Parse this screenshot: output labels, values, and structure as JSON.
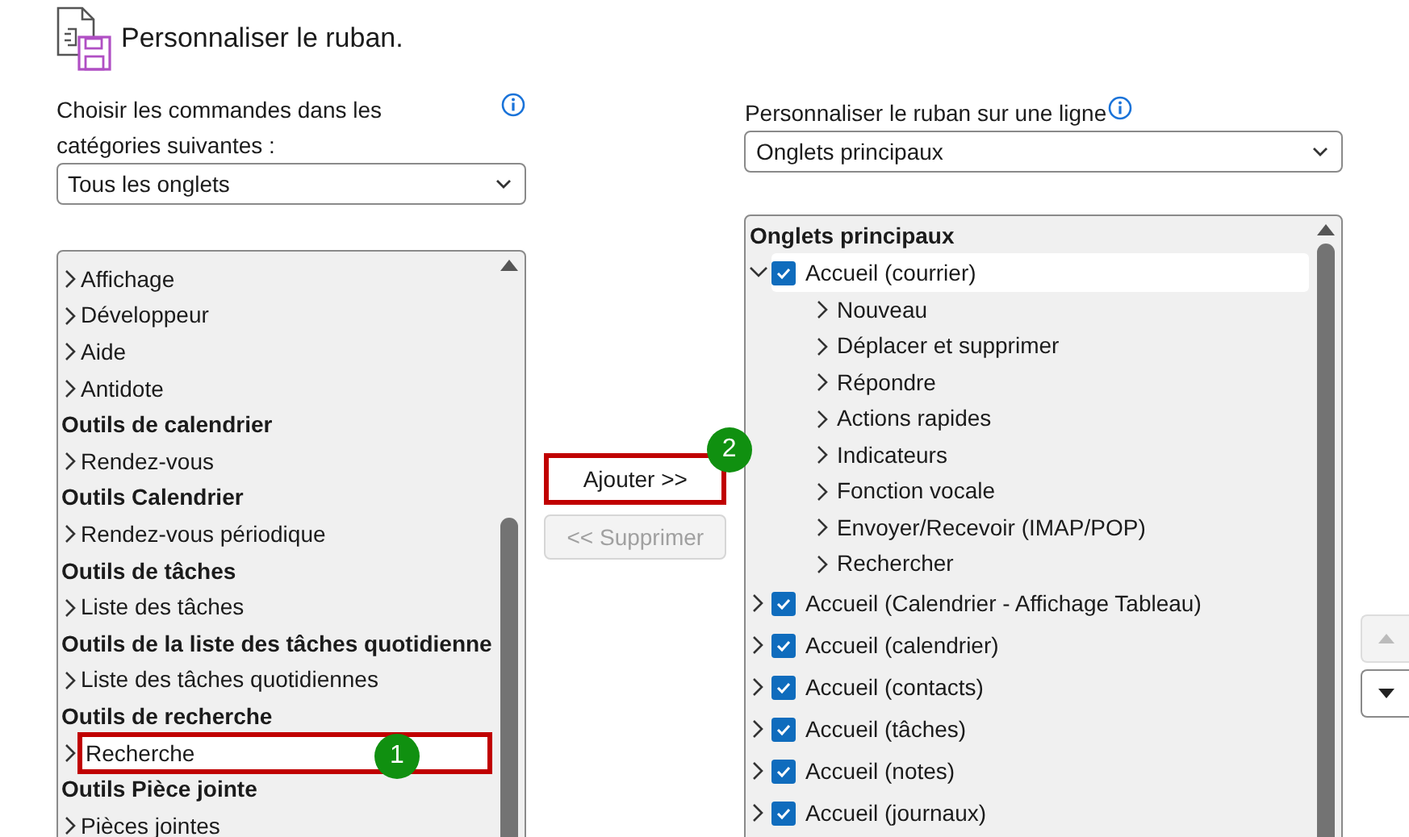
{
  "header": {
    "title": "Personnaliser le ruban."
  },
  "commands_panel": {
    "label": "Choisir les commandes dans les catégories suivantes :",
    "dropdown_value": "Tous les onglets",
    "items": [
      {
        "kind": "tab",
        "label": "Affichage",
        "selected": false
      },
      {
        "kind": "tab",
        "label": "Développeur",
        "selected": false
      },
      {
        "kind": "tab",
        "label": "Aide",
        "selected": false
      },
      {
        "kind": "tab",
        "label": "Antidote",
        "selected": false
      },
      {
        "kind": "group",
        "label": "Outils de calendrier",
        "selected": false
      },
      {
        "kind": "tab",
        "label": "Rendez-vous",
        "selected": false
      },
      {
        "kind": "group",
        "label": "Outils Calendrier",
        "selected": false
      },
      {
        "kind": "tab",
        "label": "Rendez-vous périodique",
        "selected": false
      },
      {
        "kind": "group",
        "label": "Outils de tâches",
        "selected": false
      },
      {
        "kind": "tab",
        "label": "Liste des tâches",
        "selected": false
      },
      {
        "kind": "group",
        "label": "Outils de la liste des tâches quotidienne",
        "selected": false
      },
      {
        "kind": "tab",
        "label": "Liste des tâches quotidiennes",
        "selected": false
      },
      {
        "kind": "group",
        "label": "Outils de recherche",
        "selected": false
      },
      {
        "kind": "tab",
        "label": "Recherche",
        "selected": true,
        "callout": "1"
      },
      {
        "kind": "group",
        "label": "Outils Pièce jointe",
        "selected": false
      },
      {
        "kind": "tab",
        "label": "Pièces jointes",
        "selected": false
      }
    ]
  },
  "buttons": [
    {
      "label": "Ajouter >>",
      "disabled": false,
      "callout": "2"
    },
    {
      "label": "<< Supprimer",
      "disabled": true
    }
  ],
  "ribbon_panel": {
    "label": "Personnaliser le ruban sur une ligne",
    "dropdown_value": "Onglets principaux",
    "tree_title": "Onglets principaux",
    "tabs": [
      {
        "label": "Accueil (courrier)",
        "checked": true,
        "expanded": true,
        "selected": true,
        "children": [
          {
            "label": "Nouveau"
          },
          {
            "label": "Déplacer et supprimer"
          },
          {
            "label": "Répondre"
          },
          {
            "label": "Actions rapides"
          },
          {
            "label": "Indicateurs"
          },
          {
            "label": "Fonction vocale"
          },
          {
            "label": "Envoyer/Recevoir (IMAP/POP)"
          },
          {
            "label": "Rechercher"
          }
        ]
      },
      {
        "label": "Accueil (Calendrier - Affichage Tableau)",
        "checked": true,
        "expanded": false,
        "selected": false
      },
      {
        "label": "Accueil (calendrier)",
        "checked": true,
        "expanded": false,
        "selected": false
      },
      {
        "label": "Accueil (contacts)",
        "checked": true,
        "expanded": false,
        "selected": false
      },
      {
        "label": "Accueil (tâches)",
        "checked": true,
        "expanded": false,
        "selected": false
      },
      {
        "label": "Accueil (notes)",
        "checked": true,
        "expanded": false,
        "selected": false
      },
      {
        "label": "Accueil (journaux)",
        "checked": true,
        "expanded": false,
        "selected": false
      }
    ]
  },
  "order_buttons": [
    {
      "kind": "up",
      "disabled": true
    },
    {
      "kind": "down",
      "disabled": false
    }
  ]
}
